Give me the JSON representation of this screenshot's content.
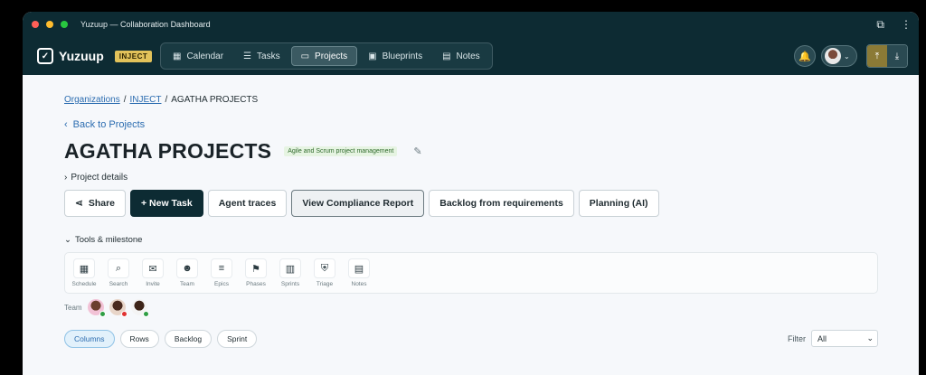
{
  "window": {
    "title": "Yuzuup — Collaboration Dashboard"
  },
  "colors": {
    "header_bg": "#0d2b33",
    "accent_link": "#2b6cb0",
    "badge": "#e2c25a",
    "tag_bg": "#e6f4e2"
  },
  "app": {
    "name": "Yuzuup",
    "badge": "INJECT",
    "nav": [
      {
        "label": "Calendar",
        "icon": "calendar-icon",
        "glyph": "▦"
      },
      {
        "label": "Tasks",
        "icon": "tasks-icon",
        "glyph": "☰"
      },
      {
        "label": "Projects",
        "icon": "folder-icon",
        "glyph": "▭",
        "active": true
      },
      {
        "label": "Blueprints",
        "icon": "blueprints-icon",
        "glyph": "▣"
      },
      {
        "label": "Notes",
        "icon": "notes-icon",
        "glyph": "▤"
      }
    ]
  },
  "breadcrumb": {
    "item1": "Organizations",
    "item2": "INJECT",
    "current": "AGATHA PROJECTS",
    "sep": "/"
  },
  "back_link": "Back to Projects",
  "project": {
    "title": "AGATHA PROJECTS",
    "tag": "Agile and Scrum project management"
  },
  "details_label": "Project details",
  "actions": {
    "share": "Share",
    "new_task": "+ New Task",
    "agent_traces": "Agent traces",
    "compliance": "View Compliance Report",
    "backlog": "Backlog from requirements",
    "planning": "Planning (AI)"
  },
  "tools_label": "Tools & milestone",
  "tools": [
    {
      "label": "Schedule",
      "icon": "schedule-icon",
      "glyph": "▦"
    },
    {
      "label": "Search",
      "icon": "search-icon",
      "glyph": "⌕"
    },
    {
      "label": "Invite",
      "icon": "mail-icon",
      "glyph": "✉"
    },
    {
      "label": "Team",
      "icon": "team-icon",
      "glyph": "☻"
    },
    {
      "label": "Epics",
      "icon": "epics-icon",
      "glyph": "≡"
    },
    {
      "label": "Phases",
      "icon": "flag-icon",
      "glyph": "⚑"
    },
    {
      "label": "Sprints",
      "icon": "columns-icon",
      "glyph": "▥"
    },
    {
      "label": "Triage",
      "icon": "shield-icon",
      "glyph": "⛨"
    },
    {
      "label": "Notes",
      "icon": "notes-icon",
      "glyph": "▤"
    }
  ],
  "team_label": "Team",
  "views": {
    "columns": "Columns",
    "rows": "Rows",
    "backlog": "Backlog",
    "sprint": "Sprint"
  },
  "filter": {
    "label": "Filter",
    "value": "All"
  }
}
